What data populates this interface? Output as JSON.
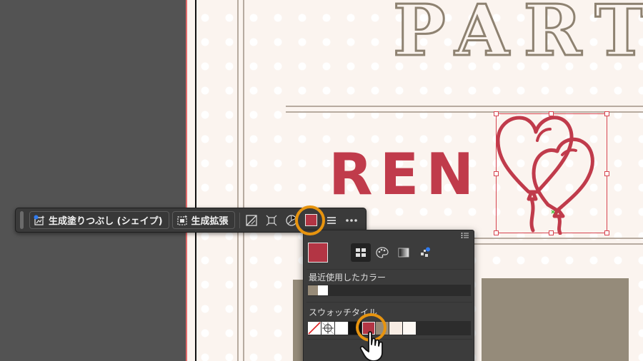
{
  "artboard": {
    "title_text": "PART",
    "subtitle_text": "REN"
  },
  "taskbar": {
    "generative_fill_label": "生成塗りつぶし (シェイプ)",
    "generative_expand_label": "生成拡張"
  },
  "swatch_panel": {
    "current_color": "#b33544",
    "recent_label": "最近使用したカラー",
    "recent_colors": [
      "#978b78",
      "#ffffff"
    ],
    "tiles_label": "スウォッチタイル",
    "tiles": [
      {
        "name": "none",
        "color": "#ffffff"
      },
      {
        "name": "registration",
        "color": "#ffffff"
      },
      {
        "name": "white",
        "color": "#ffffff"
      },
      {
        "name": "black",
        "color": "#111111"
      },
      {
        "name": "red",
        "color": "#b33544"
      },
      {
        "name": "taupe",
        "color": "#978b78"
      },
      {
        "name": "cream",
        "color": "#f7ece3"
      },
      {
        "name": "ivory",
        "color": "#fdf8f3"
      }
    ]
  },
  "colors": {
    "accent_red": "#c03b4b",
    "highlight_ring": "#e7940f",
    "ui_dark": "#3a3a3a"
  }
}
